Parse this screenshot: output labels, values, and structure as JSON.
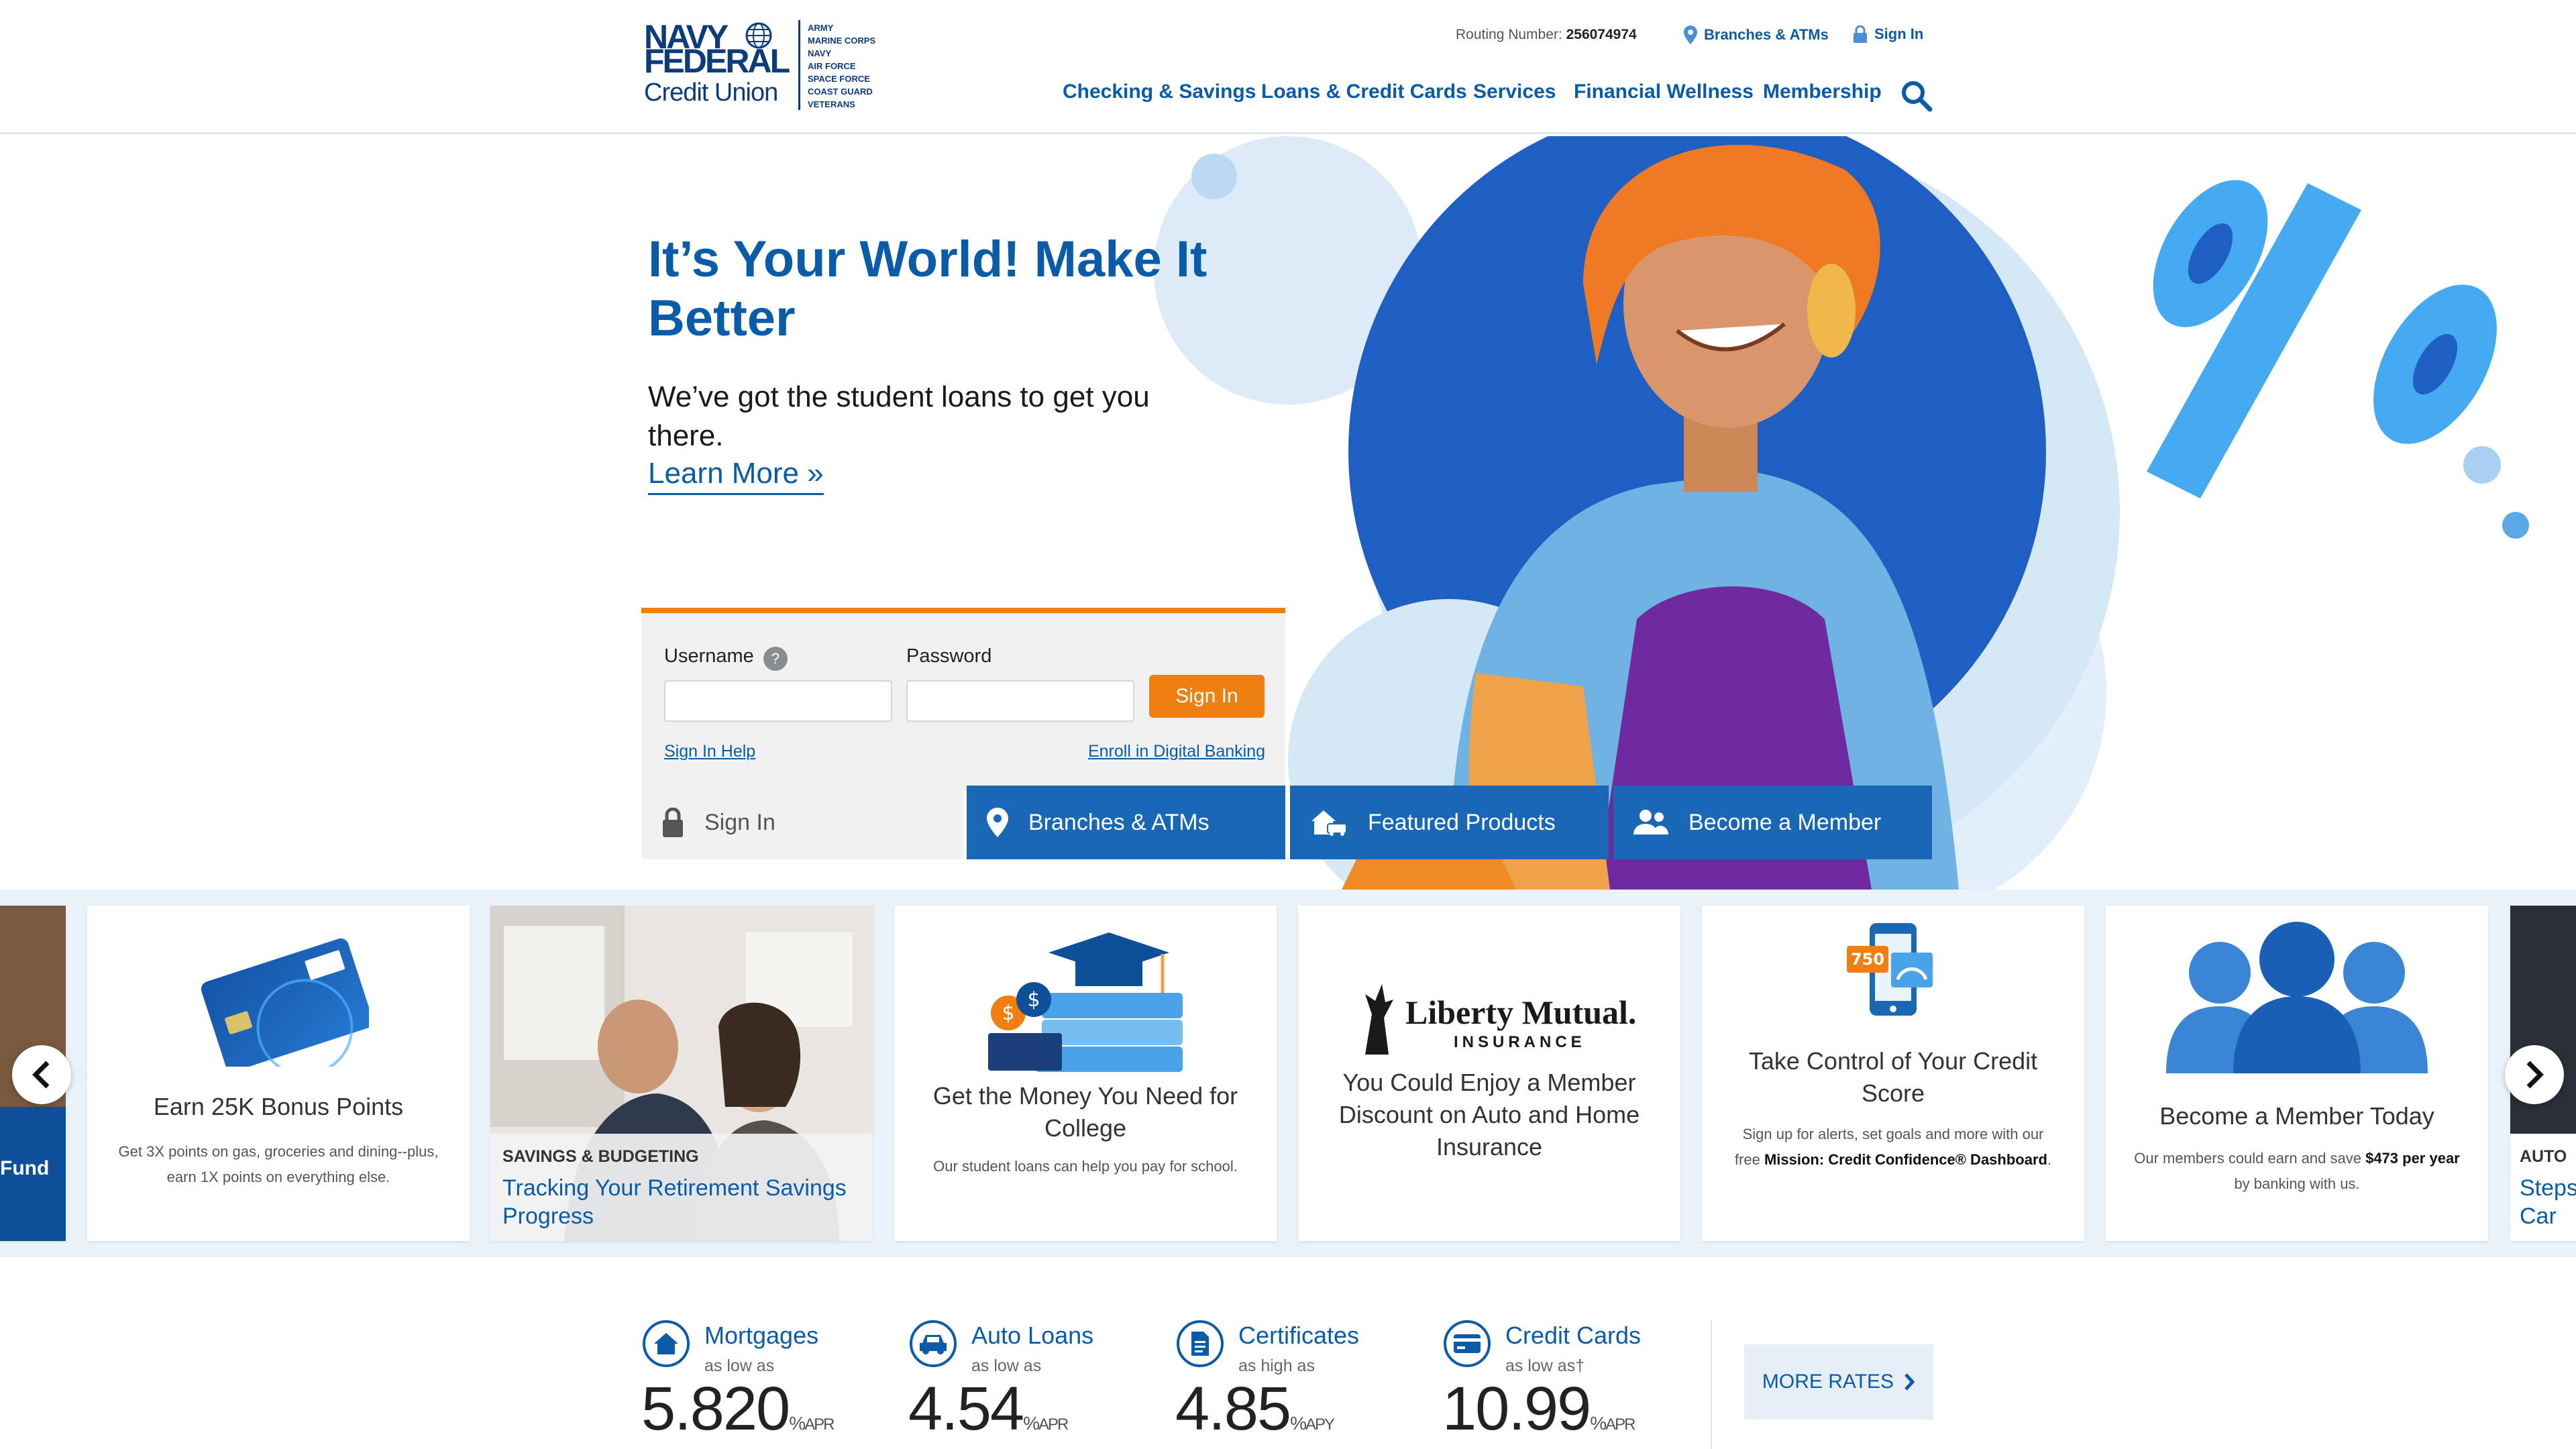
{
  "header": {
    "logo": {
      "line1": "NAVY",
      "line2": "FEDERAL",
      "line3": "Credit Union",
      "branches": [
        "ARMY",
        "MARINE CORPS",
        "NAVY",
        "AIR FORCE",
        "SPACE FORCE",
        "COAST GUARD",
        "VETERANS"
      ]
    },
    "routing_label": "Routing Number:",
    "routing_number": "256074974",
    "branches_link": "Branches & ATMs",
    "signin_link": "Sign In",
    "nav": [
      "Checking & Savings",
      "Loans & Credit Cards",
      "Services",
      "Financial Wellness",
      "Membership"
    ],
    "search_icon": "search-icon"
  },
  "hero": {
    "title": "It’s Your World! Make It Better",
    "subtitle": "We’ve got the student loans to get you there.",
    "link": "Learn More »"
  },
  "login": {
    "username_label": "Username",
    "help_glyph": "?",
    "password_label": "Password",
    "username_value": "",
    "password_value": "",
    "button": "Sign In",
    "help_link": "Sign In Help",
    "enroll_link": "Enroll in Digital Banking"
  },
  "quick_tabs": [
    {
      "label": "Sign In",
      "icon": "lock-icon"
    },
    {
      "label": "Branches & ATMs",
      "icon": "map-pin-icon"
    },
    {
      "label": "Featured Products",
      "icon": "house-car-icon"
    },
    {
      "label": "Become a Member",
      "icon": "people-icon"
    }
  ],
  "cards": {
    "left_partial": {
      "label": "Fund"
    },
    "c1": {
      "title": "Earn 25K Bonus Points",
      "desc": "Get 3X points on gas, groceries and dining--plus, earn 1X points on everything else."
    },
    "c2": {
      "category": "SAVINGS & BUDGETING",
      "title": "Tracking Your Retirement Savings Progress"
    },
    "c3": {
      "title": "Get the Money You Need for College",
      "desc": "Our student loans can help you pay for school."
    },
    "c4": {
      "logo_name": "Liberty Mutual.",
      "logo_sub": "INSURANCE",
      "title": "You Could Enjoy a Member Discount on Auto and Home Insurance"
    },
    "c5": {
      "score": "750",
      "title": "Take Control of Your Credit Score",
      "desc_a": "Sign up for alerts, set goals and more with our free ",
      "desc_b": "Mission: Credit Confidence® Dashboard",
      "desc_c": "."
    },
    "c6": {
      "title": "Become a Member Today",
      "desc_a": "Our members could earn and save ",
      "desc_b": "$473 per year",
      "desc_c": " by banking with us."
    },
    "right_partial": {
      "category": "AUTO",
      "title": "Steps Car"
    }
  },
  "rates": [
    {
      "name": "Mortgages",
      "sub": "as low as",
      "value": "5.820",
      "pct": "%",
      "unit": "APR",
      "icon": "house-icon"
    },
    {
      "name": "Auto Loans",
      "sub": "as low as",
      "value": "4.54",
      "pct": "%",
      "unit": "APR",
      "icon": "car-icon"
    },
    {
      "name": "Certificates",
      "sub": "as high as",
      "value": "4.85",
      "pct": "%",
      "unit": "APY",
      "icon": "document-icon"
    },
    {
      "name": "Credit Cards",
      "sub": "as low as†",
      "value": "10.99",
      "pct": "%",
      "unit": "APR",
      "icon": "credit-card-icon"
    }
  ],
  "more_rates": "MORE RATES",
  "colors": {
    "brand_blue": "#0a5ca8",
    "navy": "#0c3c7a",
    "orange": "#f07f11",
    "tab_blue": "#1a67b6",
    "strip_bg": "#eaf2f9"
  }
}
